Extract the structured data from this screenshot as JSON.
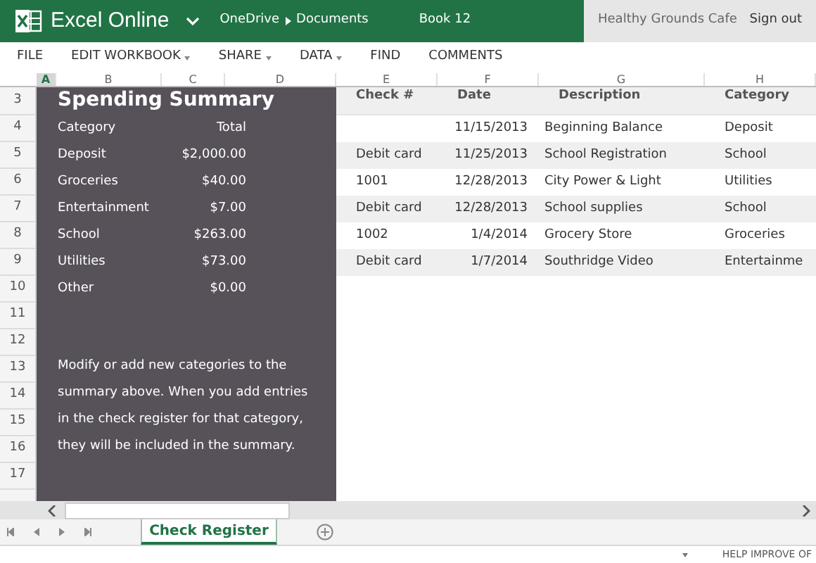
{
  "header": {
    "app_name": "Excel Online",
    "breadcrumb": [
      "OneDrive",
      "Documents"
    ],
    "doc_title": "Book 12",
    "user": "Healthy Grounds Cafe",
    "sign_out": "Sign out"
  },
  "menu": [
    {
      "label": "FILE",
      "dropdown": false
    },
    {
      "label": "EDIT WORKBOOK",
      "dropdown": true
    },
    {
      "label": "SHARE",
      "dropdown": true
    },
    {
      "label": "DATA",
      "dropdown": true
    },
    {
      "label": "FIND",
      "dropdown": false
    },
    {
      "label": "COMMENTS",
      "dropdown": false
    }
  ],
  "columns": [
    {
      "label": "A",
      "selected": true
    },
    {
      "label": "B",
      "selected": false
    },
    {
      "label": "C",
      "selected": false
    },
    {
      "label": "D",
      "selected": false
    },
    {
      "label": "E",
      "selected": false
    },
    {
      "label": "F",
      "selected": false
    },
    {
      "label": "G",
      "selected": false
    },
    {
      "label": "H",
      "selected": false
    }
  ],
  "row_numbers": [
    "3",
    "4",
    "5",
    "6",
    "7",
    "8",
    "9",
    "10",
    "11",
    "12",
    "13",
    "14",
    "15",
    "16",
    "17"
  ],
  "summary": {
    "title": "Spending Summary",
    "header": [
      "Category",
      "Total"
    ],
    "rows": [
      {
        "category": "Deposit",
        "total": "$2,000.00"
      },
      {
        "category": "Groceries",
        "total": "$40.00"
      },
      {
        "category": "Entertainment",
        "total": "$7.00"
      },
      {
        "category": "School",
        "total": "$263.00"
      },
      {
        "category": "Utilities",
        "total": "$73.00"
      },
      {
        "category": "Other",
        "total": "$0.00"
      }
    ],
    "note": "Modify or add new categories to the summary above. When you add entries in the check register for that category, they will be included in the summary."
  },
  "register": {
    "columns": [
      "Check #",
      "Date",
      "Description",
      "Category"
    ],
    "rows": [
      {
        "check": "",
        "date": "11/15/2013",
        "description": "Beginning Balance",
        "category": "Deposit"
      },
      {
        "check": "Debit card",
        "date": "11/25/2013",
        "description": "School Registration",
        "category": "School"
      },
      {
        "check": "1001",
        "date": "12/28/2013",
        "description": "City Power & Light",
        "category": "Utilities"
      },
      {
        "check": "Debit card",
        "date": "12/28/2013",
        "description": "School supplies",
        "category": "School"
      },
      {
        "check": "1002",
        "date": "1/4/2014",
        "description": "Grocery Store",
        "category": "Groceries"
      },
      {
        "check": "Debit card",
        "date": "1/7/2014",
        "description": "Southridge Video",
        "category": "Entertainme"
      }
    ]
  },
  "sheet_tabs": [
    {
      "label": "Check Register",
      "selected": true
    }
  ],
  "status": {
    "text": "HELP IMPROVE OF"
  }
}
